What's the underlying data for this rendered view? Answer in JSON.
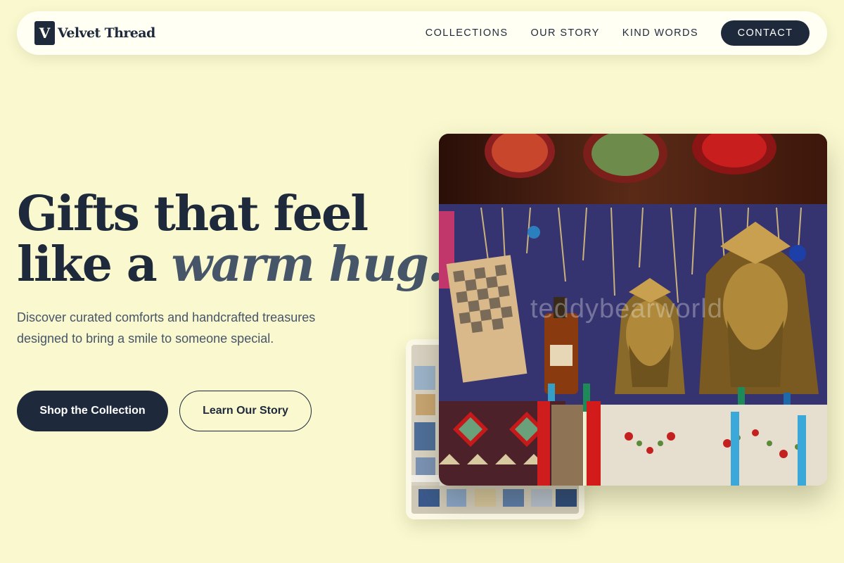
{
  "brand": {
    "mark": "V",
    "name": "Velvet Thread"
  },
  "nav": {
    "links": [
      "COLLECTIONS",
      "OUR STORY",
      "KIND WORDS"
    ],
    "cta": "CONTACT"
  },
  "hero": {
    "title_line1": "Gifts that feel",
    "title_line2_plain": "like a ",
    "title_line2_accent": "warm hug.",
    "subtitle": "Discover curated comforts and handcrafted treasures designed to bring a smile to someone special.",
    "primary_button": "Shop the Collection",
    "secondary_button": "Learn Our Story"
  },
  "images": {
    "main_watermark": "teddybearworld"
  },
  "colors": {
    "background": "#f9f8cf",
    "navy": "#1e293b",
    "slate": "#475569",
    "nav_bg": "#fffff4"
  }
}
